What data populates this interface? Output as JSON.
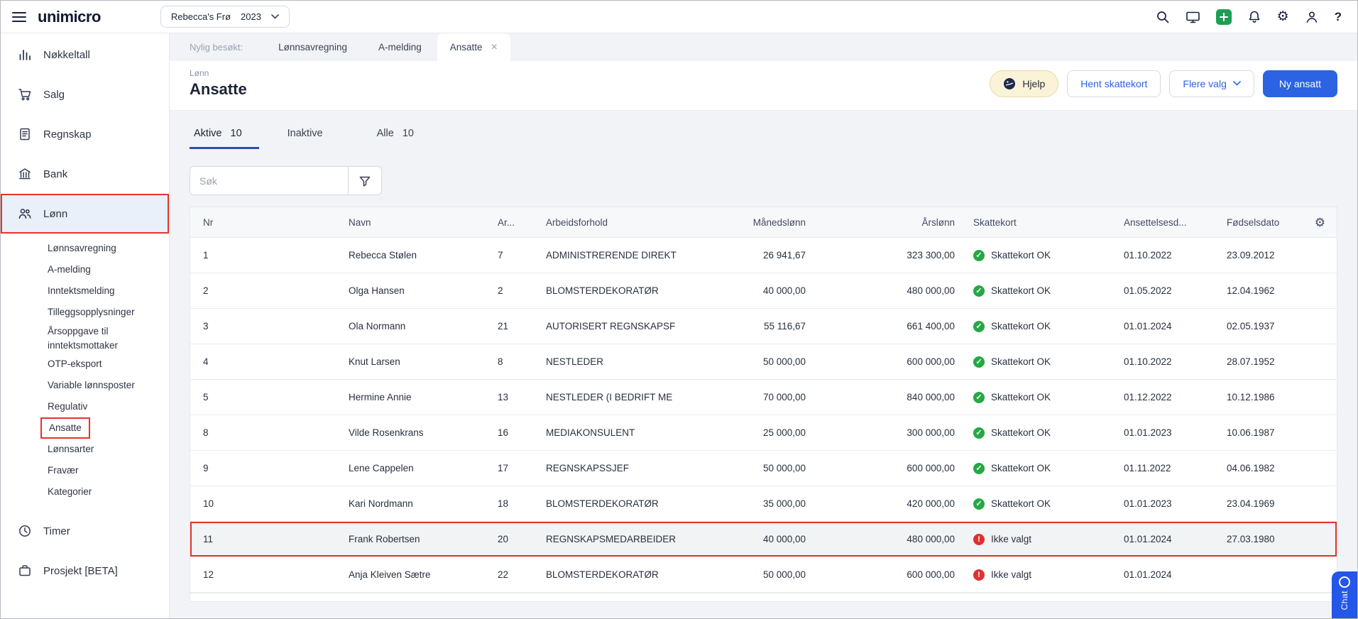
{
  "topbar": {
    "logo": "unimicro",
    "company": {
      "name": "Rebecca's Frø",
      "year": "2023"
    }
  },
  "sidebar": {
    "items": [
      {
        "label": "Nøkkeltall"
      },
      {
        "label": "Salg"
      },
      {
        "label": "Regnskap"
      },
      {
        "label": "Bank"
      },
      {
        "label": "Lønn",
        "active": true
      },
      {
        "label": "Timer"
      },
      {
        "label": "Prosjekt [BETA]"
      }
    ],
    "lonn_submenu": [
      {
        "label": "Lønnsavregning"
      },
      {
        "label": "A-melding"
      },
      {
        "label": "Inntektsmelding"
      },
      {
        "label": "Tilleggsopplysninger"
      },
      {
        "label": "Årsoppgave til inntektsmottaker"
      },
      {
        "label": "OTP-eksport"
      },
      {
        "label": "Variable lønnsposter"
      },
      {
        "label": "Regulativ"
      },
      {
        "label": "Ansatte",
        "annotated": true
      },
      {
        "label": "Lønnsarter"
      },
      {
        "label": "Fravær"
      },
      {
        "label": "Kategorier"
      }
    ]
  },
  "tabstrip": {
    "recent_label": "Nylig besøkt:",
    "tabs": [
      {
        "label": "Lønnsavregning",
        "active": false
      },
      {
        "label": "A-melding",
        "active": false
      },
      {
        "label": "Ansatte",
        "active": true,
        "closable": true
      }
    ]
  },
  "header": {
    "breadcrumb": "Lønn",
    "title": "Ansatte",
    "help_button": "Hjelp",
    "tax_card_button": "Hent skattekort",
    "more_button": "Flere valg",
    "new_button": "Ny ansatt"
  },
  "filter_tabs": [
    {
      "label": "Aktive",
      "count": "10",
      "active": true
    },
    {
      "label": "Inaktive",
      "count": "",
      "active": false
    },
    {
      "label": "Alle",
      "count": "10",
      "active": false
    }
  ],
  "search": {
    "placeholder": "Søk"
  },
  "table": {
    "columns": [
      "Nr",
      "Navn",
      "Ar...",
      "Arbeidsforhold",
      "Månedslønn",
      "Årslønn",
      "Skattekort",
      "Ansettelsesd...",
      "Fødselsdato"
    ],
    "rows": [
      {
        "nr": "1",
        "navn": "Rebecca Stølen",
        "ar": "7",
        "arbeidsforhold": "ADMINISTRERENDE DIREKT",
        "manedslonn": "26 941,67",
        "arslonn": "323 300,00",
        "status": "ok",
        "skattekort_label": "Skattekort OK",
        "ansettelsesdato": "01.10.2022",
        "fodselsdato": "23.09.2012"
      },
      {
        "nr": "2",
        "navn": "Olga Hansen",
        "ar": "2",
        "arbeidsforhold": "BLOMSTERDEKORATØR",
        "manedslonn": "40 000,00",
        "arslonn": "480 000,00",
        "status": "ok",
        "skattekort_label": "Skattekort OK",
        "ansettelsesdato": "01.05.2022",
        "fodselsdato": "12.04.1962"
      },
      {
        "nr": "3",
        "navn": "Ola Normann",
        "ar": "21",
        "arbeidsforhold": "AUTORISERT REGNSKAPSF",
        "manedslonn": "55 116,67",
        "arslonn": "661 400,00",
        "status": "ok",
        "skattekort_label": "Skattekort OK",
        "ansettelsesdato": "01.01.2024",
        "fodselsdato": "02.05.1937"
      },
      {
        "nr": "4",
        "navn": "Knut Larsen",
        "ar": "8",
        "arbeidsforhold": "NESTLEDER",
        "manedslonn": "50 000,00",
        "arslonn": "600 000,00",
        "status": "ok",
        "skattekort_label": "Skattekort OK",
        "ansettelsesdato": "01.10.2022",
        "fodselsdato": "28.07.1952"
      },
      {
        "nr": "5",
        "navn": "Hermine Annie",
        "ar": "13",
        "arbeidsforhold": "NESTLEDER (I BEDRIFT ME",
        "manedslonn": "70 000,00",
        "arslonn": "840 000,00",
        "status": "ok",
        "skattekort_label": "Skattekort OK",
        "ansettelsesdato": "01.12.2022",
        "fodselsdato": "10.12.1986"
      },
      {
        "nr": "8",
        "navn": "Vilde Rosenkrans",
        "ar": "16",
        "arbeidsforhold": "MEDIAKONSULENT",
        "manedslonn": "25 000,00",
        "arslonn": "300 000,00",
        "status": "ok",
        "skattekort_label": "Skattekort OK",
        "ansettelsesdato": "01.01.2023",
        "fodselsdato": "10.06.1987"
      },
      {
        "nr": "9",
        "navn": "Lene Cappelen",
        "ar": "17",
        "arbeidsforhold": "REGNSKAPSSJEF",
        "manedslonn": "50 000,00",
        "arslonn": "600 000,00",
        "status": "ok",
        "skattekort_label": "Skattekort OK",
        "ansettelsesdato": "01.11.2022",
        "fodselsdato": "04.06.1982"
      },
      {
        "nr": "10",
        "navn": "Kari Nordmann",
        "ar": "18",
        "arbeidsforhold": "BLOMSTERDEKORATØR",
        "manedslonn": "35 000,00",
        "arslonn": "420 000,00",
        "status": "ok",
        "skattekort_label": "Skattekort OK",
        "ansettelsesdato": "01.01.2023",
        "fodselsdato": "23.04.1969"
      },
      {
        "nr": "11",
        "navn": "Frank Robertsen",
        "ar": "20",
        "arbeidsforhold": "REGNSKAPSMEDARBEIDER",
        "manedslonn": "40 000,00",
        "arslonn": "480 000,00",
        "status": "missing",
        "skattekort_label": "Ikke valgt",
        "ansettelsesdato": "01.01.2024",
        "fodselsdato": "27.03.1980",
        "annotated": true
      },
      {
        "nr": "12",
        "navn": "Anja Kleiven Sætre",
        "ar": "22",
        "arbeidsforhold": "BLOMSTERDEKORATØR",
        "manedslonn": "50 000,00",
        "arslonn": "600 000,00",
        "status": "missing",
        "skattekort_label": "Ikke valgt",
        "ansettelsesdato": "01.01.2024",
        "fodselsdato": ""
      }
    ]
  },
  "chat_widget": {
    "label": "Chat"
  },
  "icons": {
    "gear_glyph": "⚙",
    "help_glyph": "?",
    "close_glyph": "×",
    "check_glyph": "✓",
    "exclamation_glyph": "!"
  },
  "colors": {
    "primary_blue": "#2b63e3",
    "annotation_red": "#e5342c",
    "status_green": "#27a844",
    "status_red": "#e03131",
    "add_green": "#1f9d55",
    "help_button_bg": "#fbf3d7"
  }
}
